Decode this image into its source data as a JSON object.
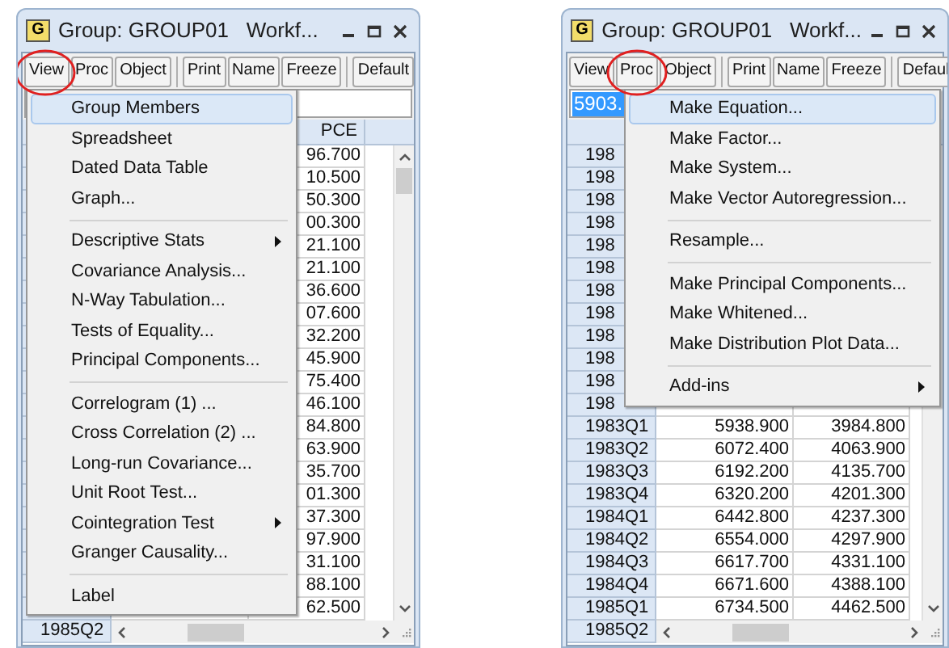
{
  "windows": [
    {
      "icon": "G",
      "title": "Group: GROUP01   Workf...",
      "toolbar": [
        [
          {
            "label": "View",
            "circled": true
          },
          {
            "label": "Proc",
            "circled": false
          },
          {
            "label": "Object",
            "circled": false
          }
        ],
        [
          {
            "label": "Print",
            "circled": false
          },
          {
            "label": "Name",
            "circled": false
          },
          {
            "label": "Freeze",
            "circled": false
          }
        ],
        [
          {
            "label": "Default",
            "circled": false
          }
        ]
      ],
      "table": {
        "header": {
          "column_3": "PCE"
        },
        "rows": [
          {
            "column_3": "96.700"
          },
          {
            "column_3": "10.500"
          },
          {
            "column_3": "50.300"
          },
          {
            "column_3": "00.300"
          },
          {
            "column_3": "21.100"
          },
          {
            "column_3": "21.100"
          },
          {
            "column_3": "36.600"
          },
          {
            "column_3": "07.600"
          },
          {
            "column_3": "32.200"
          },
          {
            "column_3": "45.900"
          },
          {
            "column_3": "75.400"
          },
          {
            "column_3": "46.100"
          },
          {
            "column_3": "84.800"
          },
          {
            "column_3": "63.900"
          },
          {
            "column_3": "35.700"
          },
          {
            "column_3": "01.300"
          },
          {
            "column_3": "37.300"
          },
          {
            "column_3": "97.900"
          },
          {
            "column_3": "31.100"
          },
          {
            "column_3": "88.100"
          },
          {
            "column_3": "62.500"
          },
          {
            "date": "1985Q2"
          }
        ]
      },
      "menu": {
        "items": [
          {
            "kind": "item",
            "label": "Group Members",
            "selected": true,
            "submenu": false
          },
          {
            "kind": "item",
            "label": "Spreadsheet",
            "selected": false,
            "submenu": false
          },
          {
            "kind": "item",
            "label": "Dated Data Table",
            "selected": false,
            "submenu": false
          },
          {
            "kind": "item",
            "label": "Graph...",
            "selected": false,
            "submenu": false
          },
          {
            "kind": "separator"
          },
          {
            "kind": "item",
            "label": "Descriptive Stats",
            "selected": false,
            "submenu": true
          },
          {
            "kind": "item",
            "label": "Covariance Analysis...",
            "selected": false,
            "submenu": false
          },
          {
            "kind": "item",
            "label": "N-Way Tabulation...",
            "selected": false,
            "submenu": false
          },
          {
            "kind": "item",
            "label": "Tests of Equality...",
            "selected": false,
            "submenu": false
          },
          {
            "kind": "item",
            "label": "Principal Components...",
            "selected": false,
            "submenu": false
          },
          {
            "kind": "separator"
          },
          {
            "kind": "item",
            "label": "Correlogram (1) ...",
            "selected": false,
            "submenu": false
          },
          {
            "kind": "item",
            "label": "Cross Correlation (2) ...",
            "selected": false,
            "submenu": false
          },
          {
            "kind": "item",
            "label": "Long-run Covariance...",
            "selected": false,
            "submenu": false
          },
          {
            "kind": "item",
            "label": "Unit Root Test...",
            "selected": false,
            "submenu": false
          },
          {
            "kind": "item",
            "label": "Cointegration Test",
            "selected": false,
            "submenu": true
          },
          {
            "kind": "item",
            "label": "Granger Causality...",
            "selected": false,
            "submenu": false
          },
          {
            "kind": "separator"
          },
          {
            "kind": "item",
            "label": "Label",
            "selected": false,
            "submenu": false
          }
        ]
      }
    },
    {
      "icon": "G",
      "title": "Group: GROUP01   Workf...",
      "toolbar": [
        [
          {
            "label": "View",
            "circled": false
          },
          {
            "label": "Proc",
            "circled": true
          },
          {
            "label": "Object",
            "circled": false
          }
        ],
        [
          {
            "label": "Print",
            "circled": false
          },
          {
            "label": "Name",
            "circled": false
          },
          {
            "label": "Freeze",
            "circled": false
          }
        ],
        [
          {
            "label": "Defaul",
            "circled": false
          }
        ]
      ],
      "edit_field": {
        "value": "5903.",
        "text_selected": true
      },
      "table": {
        "rows": [
          {
            "date": "198"
          },
          {
            "date": "198"
          },
          {
            "date": "198"
          },
          {
            "date": "198"
          },
          {
            "date": "198"
          },
          {
            "date": "198"
          },
          {
            "date": "198"
          },
          {
            "date": "198"
          },
          {
            "date": "198"
          },
          {
            "date": "198"
          },
          {
            "date": "198"
          },
          {
            "date": "198"
          },
          {
            "date": "1983Q1",
            "column_2": "5938.900",
            "column_3": "3984.800"
          },
          {
            "date": "1983Q2",
            "column_2": "6072.400",
            "column_3": "4063.900"
          },
          {
            "date": "1983Q3",
            "column_2": "6192.200",
            "column_3": "4135.700"
          },
          {
            "date": "1983Q4",
            "column_2": "6320.200",
            "column_3": "4201.300"
          },
          {
            "date": "1984Q1",
            "column_2": "6442.800",
            "column_3": "4237.300"
          },
          {
            "date": "1984Q2",
            "column_2": "6554.000",
            "column_3": "4297.900"
          },
          {
            "date": "1984Q3",
            "column_2": "6617.700",
            "column_3": "4331.100"
          },
          {
            "date": "1984Q4",
            "column_2": "6671.600",
            "column_3": "4388.100"
          },
          {
            "date": "1985Q1",
            "column_2": "6734.500",
            "column_3": "4462.500"
          },
          {
            "date": "1985Q2"
          }
        ]
      },
      "menu": {
        "items": [
          {
            "kind": "item",
            "label": "Make Equation...",
            "selected": true,
            "submenu": false
          },
          {
            "kind": "item",
            "label": "Make Factor...",
            "selected": false,
            "submenu": false
          },
          {
            "kind": "item",
            "label": "Make System...",
            "selected": false,
            "submenu": false
          },
          {
            "kind": "item",
            "label": "Make Vector Autoregression...",
            "selected": false,
            "submenu": false
          },
          {
            "kind": "separator"
          },
          {
            "kind": "item",
            "label": "Resample...",
            "selected": false,
            "submenu": false
          },
          {
            "kind": "separator"
          },
          {
            "kind": "item",
            "label": "Make Principal Components...",
            "selected": false,
            "submenu": false
          },
          {
            "kind": "item",
            "label": "Make Whitened...",
            "selected": false,
            "submenu": false
          },
          {
            "kind": "item",
            "label": "Make Distribution Plot Data...",
            "selected": false,
            "submenu": false
          },
          {
            "kind": "separator"
          },
          {
            "kind": "item",
            "label": "Add-ins",
            "selected": false,
            "submenu": true
          }
        ]
      }
    }
  ]
}
